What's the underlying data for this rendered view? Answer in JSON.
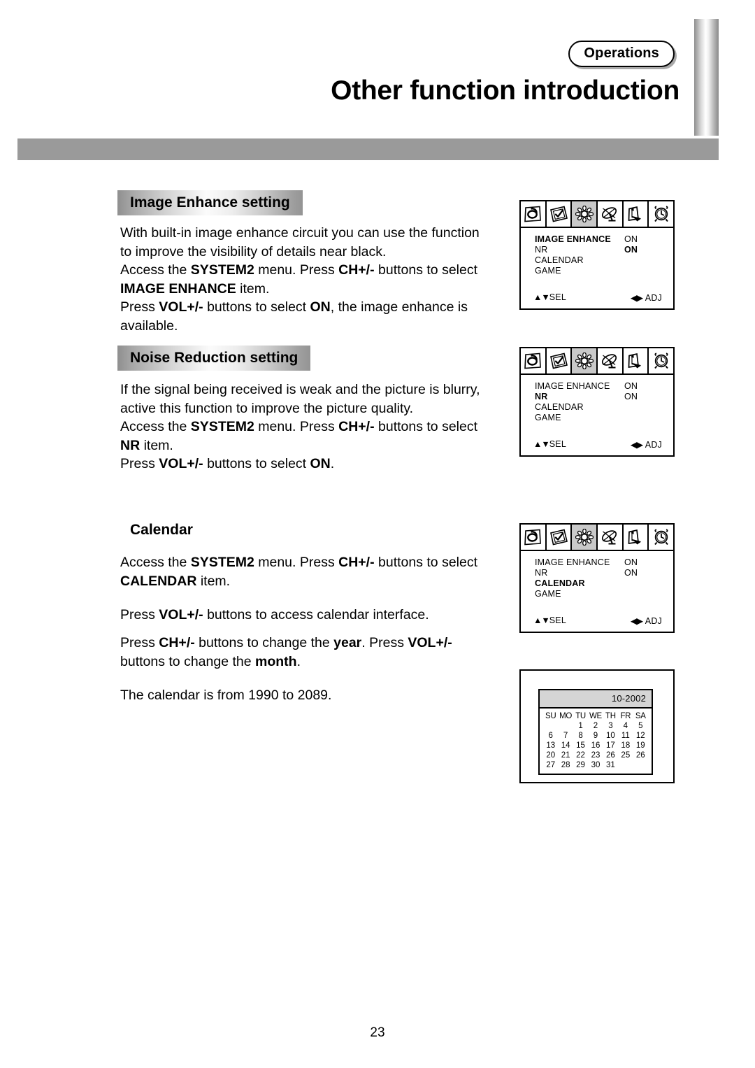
{
  "header": {
    "badge_label": "Operations",
    "title": "Other function introduction"
  },
  "sections": [
    {
      "heading": "Image Enhance setting",
      "paragraphs": [
        "With built-in image enhance circuit you can use the function to improve the visibility of details near black.",
        "Access the SYSTEM2 menu. Press CH+/- buttons to select IMAGE ENHANCE item.",
        "Press VOL+/- buttons to select ON, the image enhance is available."
      ]
    },
    {
      "heading": "Noise Reduction setting",
      "paragraphs": [
        "If the signal being received is weak and the picture is blurry, active this function to improve the picture quality.",
        "Access the SYSTEM2 menu. Press CH+/- buttons to select NR item.",
        "Press VOL+/- buttons to select ON."
      ]
    },
    {
      "heading": "Calendar",
      "paragraphs": [
        "Access the SYSTEM2 menu. Press CH+/- buttons to select CALENDAR item.",
        "Press VOL+/- buttons to access calendar interface.",
        "Press CH+/- buttons to change the year. Press VOL+/- buttons to change the month.",
        "The calendar is from 1990 to 2089."
      ]
    }
  ],
  "osd": {
    "tab_icons": [
      "eye-icon",
      "picture-check-icon",
      "flower-icon",
      "satellite-dish-icon",
      "arrow-pointer-icon",
      "alarm-clock-icon"
    ],
    "active_tab_index": 2,
    "footer_select": "SEL",
    "footer_adjust": "ADJ",
    "footer_select_arrows": "▲▼",
    "footer_adjust_arrows": "◀▶",
    "menus": [
      {
        "rows": [
          {
            "label": "IMAGE ENHANCE",
            "value": "ON",
            "label_bold": true,
            "value_bold": false
          },
          {
            "label": "NR",
            "value": "ON",
            "label_bold": false,
            "value_bold": true
          },
          {
            "label": "CALENDAR",
            "value": "",
            "label_bold": false,
            "value_bold": false
          },
          {
            "label": "GAME",
            "value": "",
            "label_bold": false,
            "value_bold": false
          }
        ]
      },
      {
        "rows": [
          {
            "label": "IMAGE ENHANCE",
            "value": "ON",
            "label_bold": false,
            "value_bold": false
          },
          {
            "label": "NR",
            "value": "ON",
            "label_bold": true,
            "value_bold": false
          },
          {
            "label": "CALENDAR",
            "value": "",
            "label_bold": false,
            "value_bold": false
          },
          {
            "label": "GAME",
            "value": "",
            "label_bold": false,
            "value_bold": false
          }
        ]
      },
      {
        "rows": [
          {
            "label": "IMAGE ENHANCE",
            "value": "ON",
            "label_bold": false,
            "value_bold": false
          },
          {
            "label": "NR",
            "value": "ON",
            "label_bold": false,
            "value_bold": false
          },
          {
            "label": "CALENDAR",
            "value": "",
            "label_bold": true,
            "value_bold": false
          },
          {
            "label": "GAME",
            "value": "",
            "label_bold": false,
            "value_bold": false
          }
        ]
      }
    ]
  },
  "calendar": {
    "month_year": "10-2002",
    "day_headers": [
      "SU",
      "MO",
      "TU",
      "WE",
      "TH",
      "FR",
      "SA"
    ],
    "weeks": [
      [
        "",
        "",
        "1",
        "2",
        "3",
        "4",
        "5"
      ],
      [
        "6",
        "7",
        "8",
        "9",
        "10",
        "11",
        "12"
      ],
      [
        "13",
        "14",
        "15",
        "16",
        "17",
        "18",
        "19"
      ],
      [
        "20",
        "21",
        "22",
        "23",
        "26",
        "25",
        "26"
      ],
      [
        "27",
        "28",
        "29",
        "30",
        "31",
        "",
        ""
      ]
    ]
  },
  "footer": {
    "page_number": "23"
  }
}
